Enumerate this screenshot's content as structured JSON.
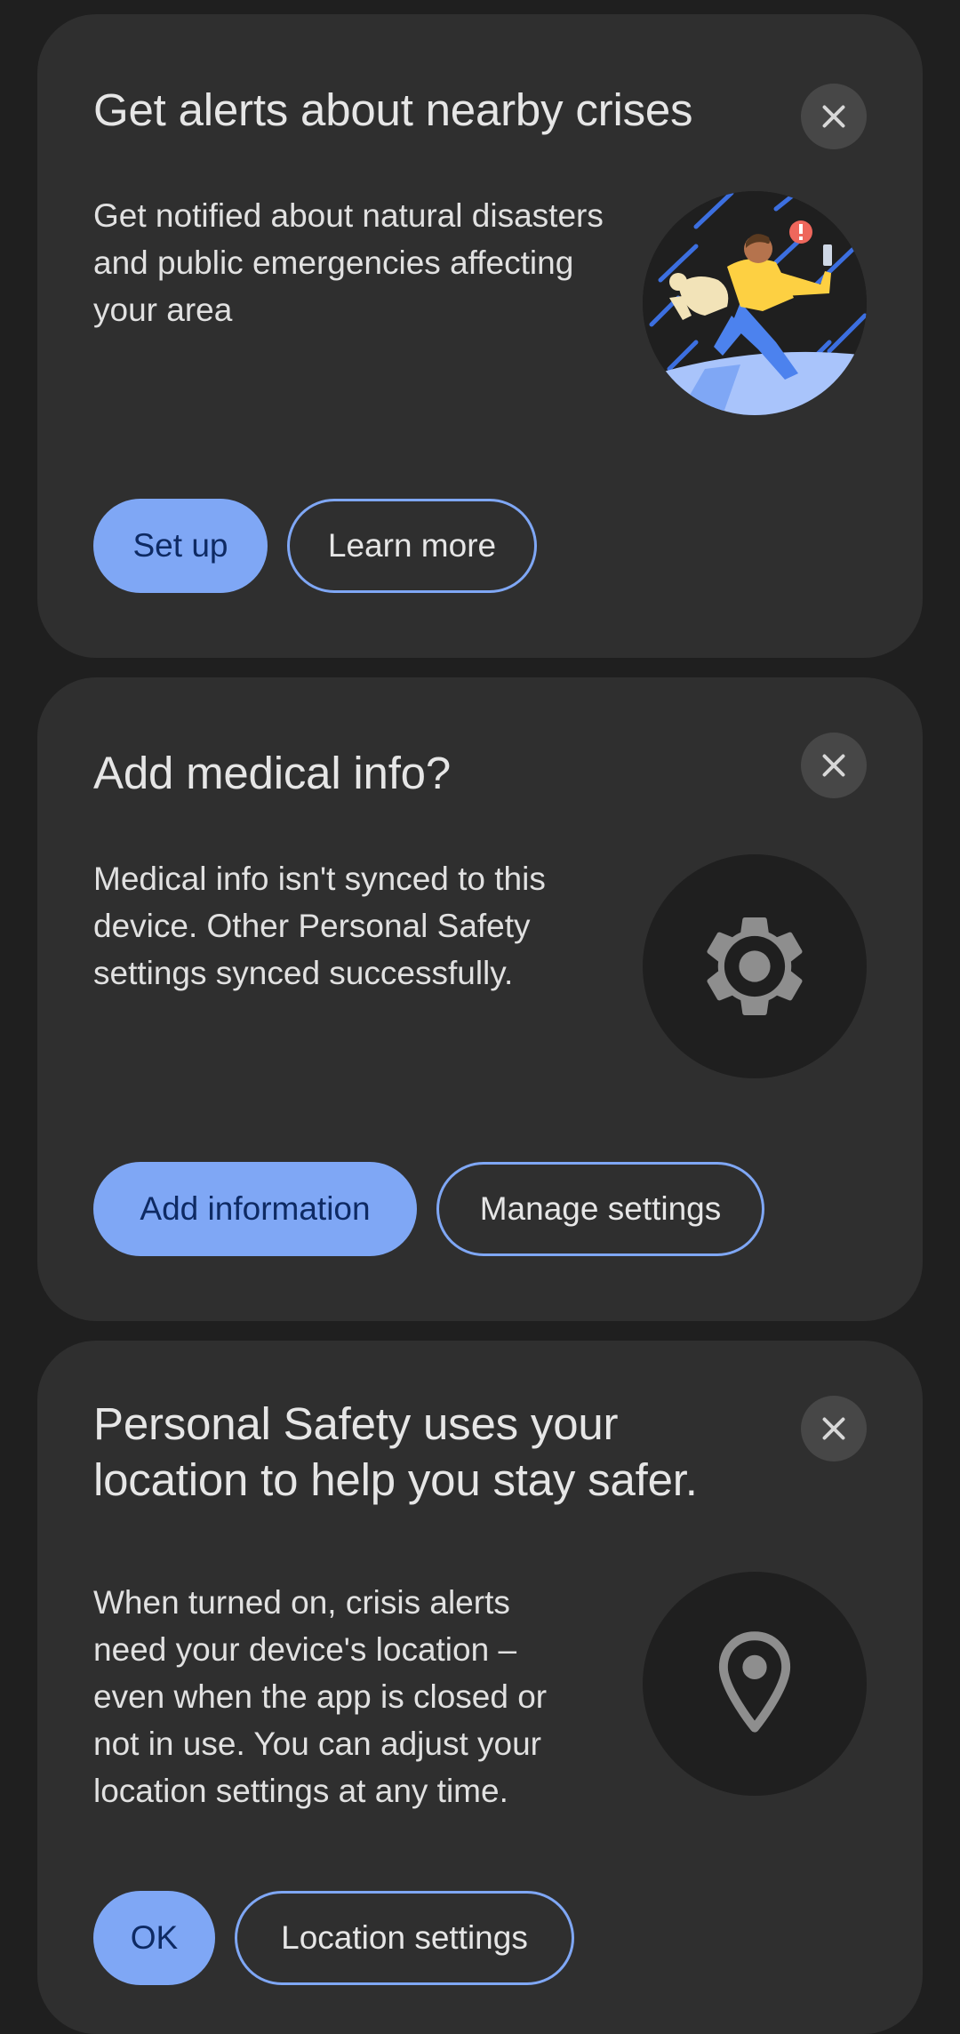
{
  "cards": [
    {
      "title": "Get alerts about nearby crises",
      "body": "Get notified about natural disasters and public emergencies affecting your area",
      "illustration": "person-running-with-dog-in-rain-illustration",
      "primary_label": "Set up",
      "secondary_label": "Learn more"
    },
    {
      "title": "Add medical info?",
      "body": "Medical info isn't synced to this device. Other Personal Safety settings synced successfully.",
      "illustration": "gear-icon",
      "primary_label": "Add information",
      "secondary_label": "Manage settings"
    },
    {
      "title_line1": "Personal Safety uses your",
      "title_line2": "location to help you stay safer.",
      "body": "When turned on, crisis alerts need your device's location – even when the app is closed or not in use. You can adjust your location settings at any time.",
      "illustration": "location-pin-icon",
      "primary_label": "OK",
      "secondary_label": "Location settings"
    }
  ],
  "colors": {
    "background": "#1f1f1f",
    "card": "#2f2f2f",
    "accent": "#7fa7f5",
    "accent_text": "#0e2a63"
  }
}
